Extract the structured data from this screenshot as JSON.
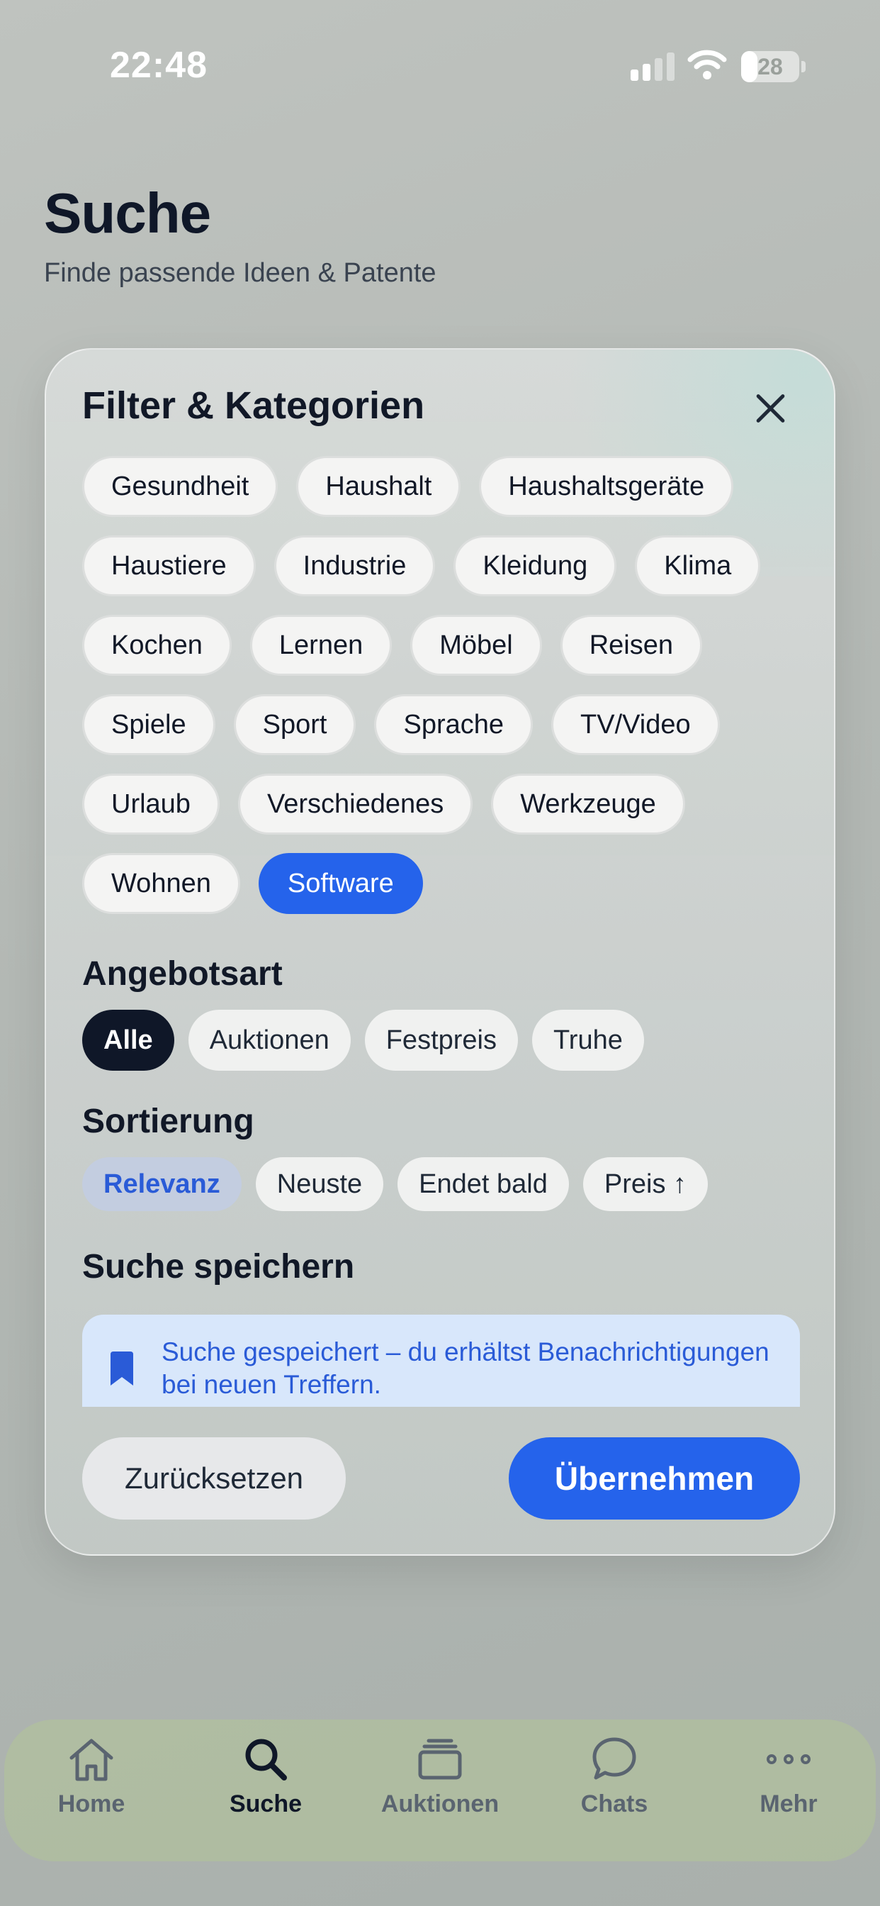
{
  "status": {
    "time": "22:48",
    "battery": "28",
    "battery_fraction": 0.28
  },
  "header": {
    "title": "Suche",
    "subtitle": "Finde passende Ideen & Patente"
  },
  "sheet": {
    "title": "Filter & Kategorien",
    "category_rows": [
      [
        "Gesundheit",
        "Haushalt",
        "Haushaltsgeräte"
      ],
      [
        "Haustiere",
        "Industrie",
        "Kleidung",
        "Klima"
      ],
      [
        "Kochen",
        "Lernen",
        "Möbel",
        "Reisen"
      ],
      [
        "Spiele",
        "Sport",
        "Sprache",
        "TV/Video"
      ],
      [
        "Urlaub",
        "Verschiedenes",
        "Werkzeuge"
      ],
      [
        "Wohnen",
        "Software"
      ]
    ],
    "selected_category": "Software",
    "offer_type": {
      "title": "Angebotsart",
      "options": [
        "Alle",
        "Auktionen",
        "Festpreis",
        "Truhe"
      ],
      "selected": "Alle"
    },
    "sorting": {
      "title": "Sortierung",
      "options": [
        "Relevanz",
        "Neuste",
        "Endet bald",
        "Preis ↑"
      ],
      "selected": "Relevanz"
    },
    "save_search": {
      "title": "Suche speichern",
      "notice": "Suche gespeichert – du erhältst Benachrichtigungen bei neuen Treffern."
    },
    "reset_label": "Zurücksetzen",
    "apply_label": "Übernehmen"
  },
  "tabs": [
    {
      "label": "Home",
      "icon": "home-icon"
    },
    {
      "label": "Suche",
      "icon": "search-icon",
      "active": true
    },
    {
      "label": "Auktionen",
      "icon": "auctions-icon"
    },
    {
      "label": "Chats",
      "icon": "chat-icon"
    },
    {
      "label": "Mehr",
      "icon": "more-icon"
    }
  ],
  "colors": {
    "accent": "#2563eb",
    "dark": "#0f1728",
    "notice_bg": "#d8e7fb"
  }
}
